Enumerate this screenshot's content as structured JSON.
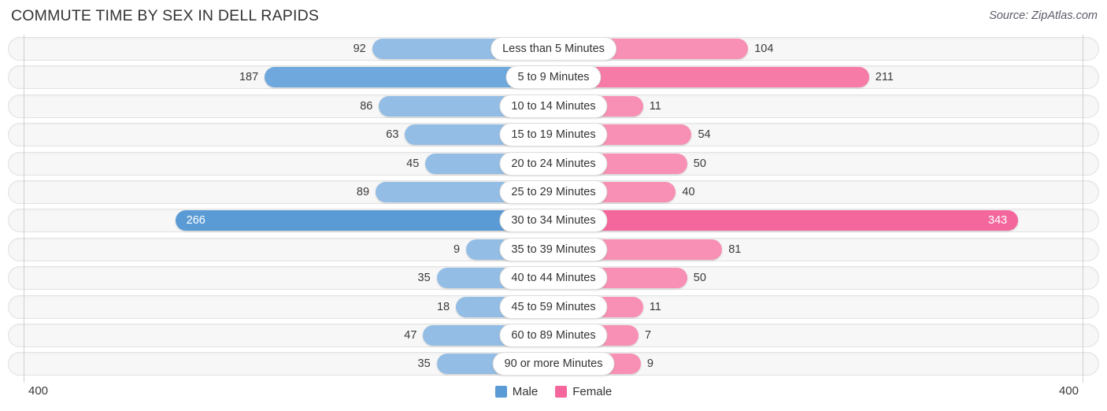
{
  "header": {
    "title": "COMMUTE TIME BY SEX IN DELL RAPIDS",
    "source": "Source: ZipAtlas.com"
  },
  "axis": {
    "left_label": "400",
    "right_label": "400",
    "max": 400
  },
  "legend": {
    "items": [
      {
        "label": "Male",
        "color": "#5b9bd5"
      },
      {
        "label": "Female",
        "color": "#f4679d"
      }
    ]
  },
  "colors": {
    "male_light": "#93bde4",
    "male_mid": "#6fa8dc",
    "male_strong": "#5b9bd5",
    "female_light": "#f790b4",
    "female_mid": "#f67ba6",
    "female_strong": "#f4679d",
    "track": "#f7f7f7",
    "gridline": "#cfcfcf"
  },
  "chart_data": {
    "type": "bar",
    "subtype": "diverging-bidirectional-bar",
    "title": "COMMUTE TIME BY SEX IN DELL RAPIDS",
    "xlabel": "",
    "ylabel": "",
    "xlim": [
      400,
      400
    ],
    "grid": true,
    "legend_position": "bottom-center",
    "categories": [
      "Less than 5 Minutes",
      "5 to 9 Minutes",
      "10 to 14 Minutes",
      "15 to 19 Minutes",
      "20 to 24 Minutes",
      "25 to 29 Minutes",
      "30 to 34 Minutes",
      "35 to 39 Minutes",
      "40 to 44 Minutes",
      "45 to 59 Minutes",
      "60 to 89 Minutes",
      "90 or more Minutes"
    ],
    "series": [
      {
        "name": "Male",
        "direction": "left",
        "values": [
          92,
          187,
          86,
          63,
          45,
          89,
          266,
          9,
          35,
          18,
          47,
          35
        ]
      },
      {
        "name": "Female",
        "direction": "right",
        "values": [
          104,
          211,
          11,
          54,
          50,
          40,
          343,
          81,
          50,
          11,
          7,
          9
        ]
      }
    ]
  },
  "rows": [
    {
      "category": "Less than 5 Minutes",
      "male": "92",
      "female": "104",
      "male_v": 92,
      "female_v": 104,
      "tone": "light"
    },
    {
      "category": "5 to 9 Minutes",
      "male": "187",
      "female": "211",
      "male_v": 187,
      "female_v": 211,
      "tone": "strong"
    },
    {
      "category": "10 to 14 Minutes",
      "male": "86",
      "female": "11",
      "male_v": 86,
      "female_v": 11,
      "tone": "light"
    },
    {
      "category": "15 to 19 Minutes",
      "male": "63",
      "female": "54",
      "male_v": 63,
      "female_v": 54,
      "tone": "light"
    },
    {
      "category": "20 to 24 Minutes",
      "male": "45",
      "female": "50",
      "male_v": 45,
      "female_v": 50,
      "tone": "light"
    },
    {
      "category": "25 to 29 Minutes",
      "male": "89",
      "female": "40",
      "male_v": 89,
      "female_v": 40,
      "tone": "light"
    },
    {
      "category": "30 to 34 Minutes",
      "male": "266",
      "female": "343",
      "male_v": 266,
      "female_v": 343,
      "tone": "emphasis"
    },
    {
      "category": "35 to 39 Minutes",
      "male": "9",
      "female": "81",
      "male_v": 9,
      "female_v": 81,
      "tone": "light"
    },
    {
      "category": "40 to 44 Minutes",
      "male": "35",
      "female": "50",
      "male_v": 35,
      "female_v": 50,
      "tone": "light"
    },
    {
      "category": "45 to 59 Minutes",
      "male": "18",
      "female": "11",
      "male_v": 18,
      "female_v": 11,
      "tone": "light"
    },
    {
      "category": "60 to 89 Minutes",
      "male": "47",
      "female": "7",
      "male_v": 47,
      "female_v": 7,
      "tone": "light"
    },
    {
      "category": "90 or more Minutes",
      "male": "35",
      "female": "9",
      "male_v": 35,
      "female_v": 9,
      "tone": "light"
    }
  ]
}
